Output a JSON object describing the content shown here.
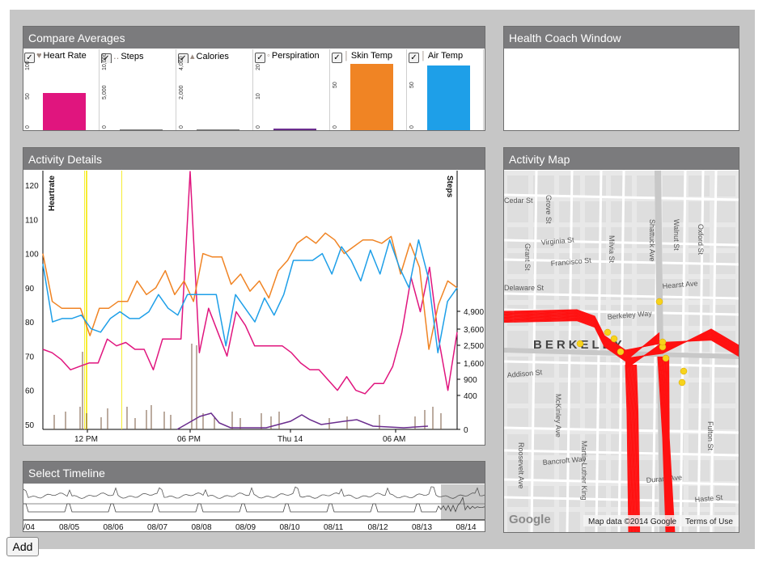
{
  "compare": {
    "title": "Compare Averages",
    "items": [
      {
        "label": "Heart Rate",
        "icon": "heart-icon",
        "ticks": [
          "100",
          "50",
          "0"
        ],
        "value": 0.56,
        "color": "#e0157e"
      },
      {
        "label": "Steps",
        "icon": "footprints-icon",
        "ticks": [
          "10,000",
          "5,000",
          "0"
        ],
        "value": 0,
        "color": "#7a7a7a"
      },
      {
        "label": "Calories",
        "icon": "flame-icon",
        "ticks": [
          "4,000",
          "2,000",
          "0"
        ],
        "value": 0,
        "color": "#7a7a7a"
      },
      {
        "label": "Perspiration",
        "icon": "droplet-icon",
        "ticks": [
          "20",
          "10",
          "0"
        ],
        "value": 0.03,
        "color": "#6a2d8e"
      },
      {
        "label": "Skin Temp",
        "icon": "thermometer-icon",
        "ticks": [
          "50",
          "0"
        ],
        "value": 1.0,
        "color": "#f08424"
      },
      {
        "label": "Air Temp",
        "icon": "thermometer-icon",
        "ticks": [
          "50",
          "0"
        ],
        "value": 0.98,
        "color": "#1e9fe8"
      }
    ]
  },
  "coach": {
    "title": "Health Coach Window"
  },
  "activity": {
    "title": "Activity Details",
    "left_axis_label": "Heartrate",
    "right_axis_label": "Steps",
    "left_ticks": [
      "120",
      "110",
      "100",
      "90",
      "80",
      "70",
      "60",
      "50"
    ],
    "right_ticks": [
      "4,900",
      "3,600",
      "2,500",
      "1,600",
      "900",
      "400",
      "0"
    ],
    "x_ticks": [
      "12 PM",
      "06 PM",
      "Thu 14",
      "06 AM"
    ]
  },
  "chart_data": {
    "type": "line",
    "series": [
      {
        "name": "Heartrate",
        "color": "#e0157e",
        "values": [
          72,
          71,
          69,
          66,
          67,
          68,
          68,
          75,
          73,
          74,
          72,
          72,
          66,
          75,
          75,
          75,
          124,
          71,
          84,
          77,
          70,
          83,
          79,
          73,
          73,
          73,
          73,
          71,
          68,
          66,
          66,
          63,
          60,
          64,
          60,
          59,
          62,
          62,
          67,
          77,
          93,
          83,
          96,
          75,
          60,
          77
        ]
      },
      {
        "name": "Skin Temp",
        "color": "#f08424",
        "values": [
          100,
          86,
          84,
          84,
          84,
          76,
          84,
          84,
          86,
          86,
          92,
          88,
          90,
          95,
          88,
          92,
          86,
          100,
          99,
          99,
          91,
          94,
          89,
          92,
          87,
          95,
          98,
          103,
          105,
          103,
          106,
          104,
          100,
          102,
          104,
          104,
          103,
          105,
          94,
          103,
          96,
          72,
          85,
          92,
          90
        ]
      },
      {
        "name": "Air Temp",
        "color": "#1e9fe8",
        "values": [
          97,
          80,
          81,
          81,
          82,
          78,
          77,
          81,
          83,
          81,
          81,
          83,
          88,
          84,
          82,
          88,
          88,
          88,
          88,
          73,
          88,
          84,
          80,
          87,
          82,
          88,
          98,
          98,
          98,
          100,
          94,
          102,
          98,
          92,
          101,
          94,
          104,
          96,
          90,
          104,
          93,
          71,
          86,
          90
        ]
      }
    ]
  },
  "timeline": {
    "title": "Select Timeline",
    "labels": [
      "/04",
      "08/05",
      "08/06",
      "08/07",
      "08/08",
      "08/09",
      "08/10",
      "08/11",
      "08/12",
      "08/13",
      "08/14"
    ]
  },
  "map": {
    "title": "Activity Map",
    "city_label": "BERKELEY",
    "streets": [
      "Cedar St",
      "Virginia St",
      "Francisco St",
      "Delaware St",
      "Hearst Ave",
      "Berkeley Way",
      "Addison St",
      "Bancroft Way",
      "Durant Ave",
      "Haste St",
      "Shattuck Ave",
      "Walnut St",
      "Oxford St",
      "Milvia St",
      "Grant St",
      "McKinley Ave",
      "Martin Luther King",
      "Roosevelt Ave",
      "Fulton St",
      "Grove St"
    ],
    "footer_data": "Map data ©2014 Google",
    "footer_terms": "Terms of Use",
    "logo": "Google"
  },
  "add_button": "Add"
}
